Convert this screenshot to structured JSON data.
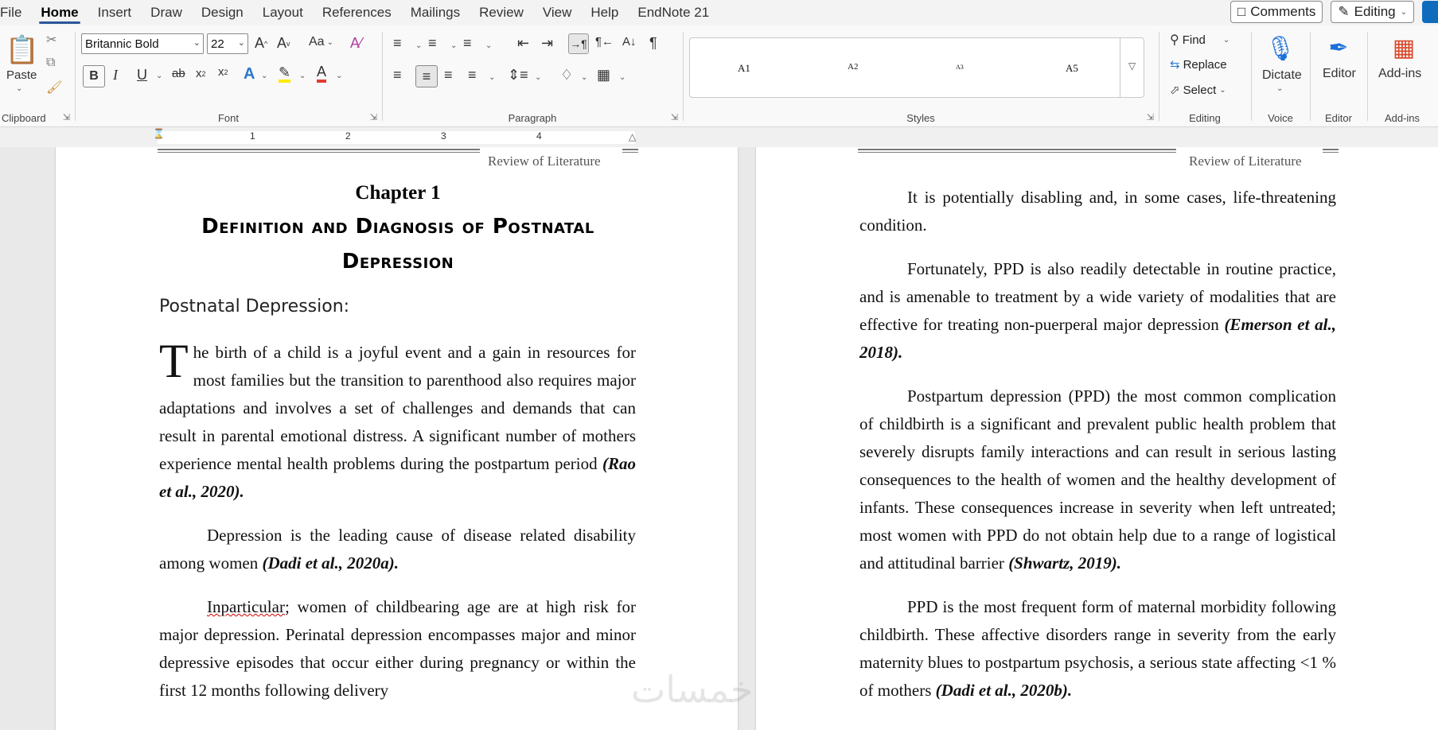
{
  "menu": {
    "tabs": [
      "File",
      "Home",
      "Insert",
      "Draw",
      "Design",
      "Layout",
      "References",
      "Mailings",
      "Review",
      "View",
      "Help",
      "EndNote 21"
    ],
    "active": "Home"
  },
  "top_right": {
    "comments": "Comments",
    "editing": "Editing"
  },
  "ribbon": {
    "clipboard": {
      "paste": "Paste",
      "label": "Clipboard"
    },
    "font": {
      "name": "Britannic Bold",
      "size": "22",
      "label": "Font",
      "case_label": "Aa"
    },
    "paragraph": {
      "label": "Paragraph"
    },
    "styles": {
      "items": [
        "A1",
        "A2",
        "A3",
        "A5"
      ],
      "label": "Styles"
    },
    "editing": {
      "find": "Find",
      "replace": "Replace",
      "select": "Select",
      "label": "Editing"
    },
    "voice": {
      "dictate": "Dictate",
      "label": "Voice"
    },
    "editor": {
      "name": "Editor",
      "label": "Editor"
    },
    "addins": {
      "name": "Add-ins",
      "label": "Add-ins"
    }
  },
  "ruler": {
    "numbers": [
      "1",
      "2",
      "3",
      "4"
    ]
  },
  "left_page": {
    "header": "Review of Literature",
    "chapter": "Chapter 1",
    "title_line1": "Definition and Diagnosis of Postnatal",
    "title_line2": "Depression",
    "subheading": "Postnatal Depression:",
    "p1_dropcap": "T",
    "p1_text": "he birth of a child is a joyful event and a gain in resources for most families but the transition to parenthood also requires major adaptations and involves a set of challenges and demands that can result in parental emotional distress. A significant number of mothers experience mental health problems during the postpartum period ",
    "p1_cite": "(Rao et al., 2020).",
    "p2_text": "Depression is the leading cause of disease related disability among women ",
    "p2_cite": "(Dadi et al., 2020a).",
    "p3_word": "Inparticular",
    "p3_text": "; women of childbearing age are at high risk for major depression. Perinatal depression encompasses major and minor depressive episodes that occur either during pregnancy or within the first 12 months following delivery"
  },
  "right_page": {
    "header": "Review of Literature",
    "p1_text": "It is potentially disabling and, in some cases, life-threatening condition.",
    "p2_text": "Fortunately, PPD is also readily detectable in routine practice, and is amenable to treatment by a wide variety of modalities that are effective for treating non-puerperal major depression ",
    "p2_cite": "(Emerson et al., 2018).",
    "p3_text": "Postpartum depression (PPD) the most common complication of childbirth is a significant and prevalent public health problem that severely disrupts family interactions and can result in serious lasting consequences to the health of women and the healthy development of infants. These consequences increase in severity when left untreated; most women with PPD do not obtain help due to a range of logistical and attitudinal barrier ",
    "p3_cite": "(Shwartz, 2019).",
    "p4_text": "PPD is the most frequent form of maternal morbidity following childbirth. These affective disorders range in severity from the early maternity blues to postpartum psychosis, a serious state affecting <1 % of mothers ",
    "p4_cite": "(Dadi et al., 2020b)."
  },
  "watermark": "خمسات",
  "colors": {
    "accent": "#2b579a",
    "highlight": "#ffff00",
    "font_color": "#e03c31"
  }
}
